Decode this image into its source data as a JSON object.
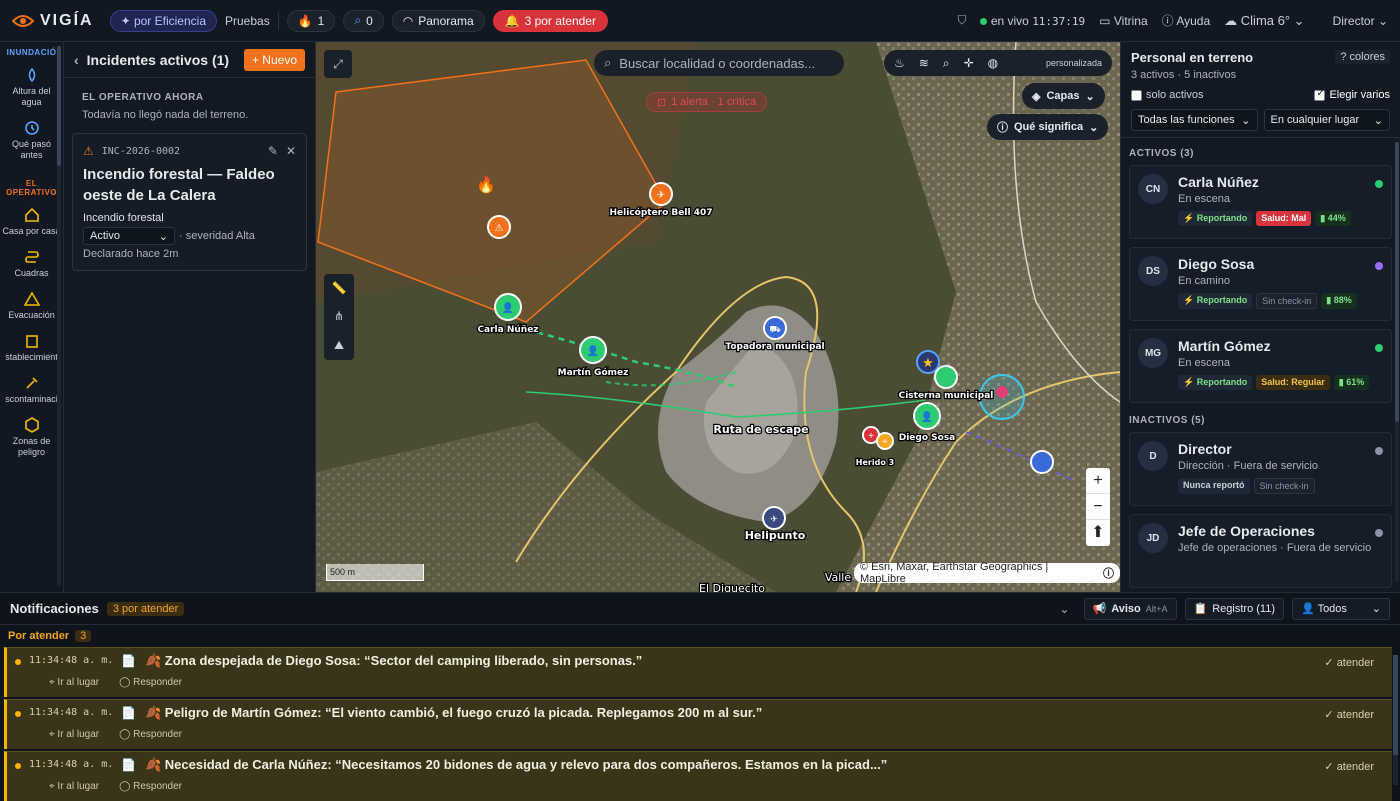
{
  "topbar": {
    "brand": "VIGÍA",
    "mode_pill": "✦ por Eficiencia",
    "pruebas": "Pruebas",
    "fire_count": "1",
    "search_count": "0",
    "panorama": "Panorama",
    "attend": "3 por atender",
    "live_label": "en vivo",
    "clock": "11:37:19",
    "vitrina": "Vitrina",
    "ayuda": "Ayuda",
    "weather": "Clima 6°",
    "role": "Director"
  },
  "leftnav": {
    "section1": "INUNDACIÓ",
    "section2": "EL OPERATIVO",
    "items": [
      {
        "label": "Altura del agua"
      },
      {
        "label": "Qué pasó antes"
      },
      {
        "label": "Casa por casa"
      },
      {
        "label": "Cuadras"
      },
      {
        "label": "Evacuación"
      },
      {
        "label": "stablecimient"
      },
      {
        "label": "scontaminaci"
      },
      {
        "label": "Zonas de peligro"
      }
    ]
  },
  "incidents": {
    "title": "Incidentes activos (1)",
    "new_label": "+ Nuevo",
    "section": "EL OPERATIVO AHORA",
    "note": "Todavía no llegó nada del terreno.",
    "card": {
      "code": "INC-2026-0002",
      "title": "Incendio forestal — Faldeo oeste de La Calera",
      "type": "Incendio forestal",
      "status": "Activo",
      "severity": "· severidad Alta",
      "declared": "Declarado hace 2m"
    }
  },
  "map": {
    "search_placeholder": "Buscar localidad o coordenadas...",
    "tools_label": "personalizada",
    "layers": "Capas",
    "meaning": "Qué significa",
    "alert": "1 alerta · 1 crítica",
    "scale": "500 m",
    "attribution": "© Esri, Maxar, Earthstar Geographics | MapLibre",
    "labels": {
      "helicopter": "Helicóptero Bell 407",
      "carla": "Carla Núñez",
      "martin": "Martín Gómez",
      "topadora": "Topadora municipal",
      "ruta": "Ruta de escape",
      "cisterna": "Cisterna municipal",
      "diego": "Diego Sosa",
      "herido": "Herido 3",
      "helipunto": "Helipunto",
      "valle": "Valle",
      "diquecito": "El Diquecito"
    }
  },
  "personnel": {
    "title": "Personal en terreno",
    "summary": "3 activos · 5 inactivos",
    "help": "? colores",
    "only_active": "solo activos",
    "pick_many": "Elegir varios",
    "filter_role": "Todas las funciones",
    "filter_place": "En cualquier lugar",
    "active_header": "ACTIVOS (3)",
    "inactive_header": "INACTIVOS (5)",
    "active": [
      {
        "initials": "CN",
        "name": "Carla Núñez",
        "status": "En escena",
        "dot": "#2ecc71",
        "tags": [
          {
            "t": "⚡ Reportando",
            "k": "rep"
          },
          {
            "t": "Salud: Mal",
            "k": "red"
          },
          {
            "t": "▮ 44%",
            "k": "grn"
          }
        ]
      },
      {
        "initials": "DS",
        "name": "Diego Sosa",
        "status": "En camino",
        "dot": "#9b6bff",
        "tags": [
          {
            "t": "⚡ Reportando",
            "k": "rep"
          },
          {
            "t": "Sin check-in",
            "k": "dim"
          },
          {
            "t": "▮ 88%",
            "k": "grn"
          }
        ]
      },
      {
        "initials": "MG",
        "name": "Martín Gómez",
        "status": "En escena",
        "dot": "#2ecc71",
        "tags": [
          {
            "t": "⚡ Reportando",
            "k": "rep"
          },
          {
            "t": "Salud: Regular",
            "k": "amb"
          },
          {
            "t": "▮ 61%",
            "k": "grn"
          }
        ]
      }
    ],
    "inactive": [
      {
        "initials": "D",
        "name": "Director",
        "status": "Dirección · Fuera de servicio",
        "dot": "#8a94a2",
        "tags": [
          {
            "t": "Nunca reportó",
            "k": "gry"
          },
          {
            "t": "Sin check-in",
            "k": "dim"
          }
        ]
      },
      {
        "initials": "JD",
        "name": "Jefe de Operaciones",
        "status": "Jefe de operaciones · Fuera de servicio",
        "dot": "#8a94a2",
        "tags": []
      }
    ]
  },
  "notifications": {
    "title": "Notificaciones",
    "badge": "3 por atender",
    "aviso": "Aviso",
    "aviso_key": "Alt+A",
    "registro": "Registro (11)",
    "todos": "Todos",
    "group": "Por atender",
    "group_count": "3",
    "go": "Ir al lugar",
    "reply": "Responder",
    "attend": "atender",
    "rows": [
      {
        "time": "11:34:48 a. m.",
        "msg": "🍂 Zona despejada de Diego Sosa: “Sector del camping liberado, sin personas.”"
      },
      {
        "time": "11:34:48 a. m.",
        "msg": "🍂 Peligro de Martín Gómez: “El viento cambió, el fuego cruzó la picada. Replegamos 200 m al sur.”"
      },
      {
        "time": "11:34:48 a. m.",
        "msg": "🍂 Necesidad de Carla Núñez: “Necesitamos 20 bidones de agua y relevo para dos compañeros. Estamos en la picad...”"
      }
    ]
  },
  "colors": {
    "accent": "#f2711c",
    "alert": "#d8323a",
    "warn": "#f5b800",
    "ok": "#2ecc71"
  }
}
